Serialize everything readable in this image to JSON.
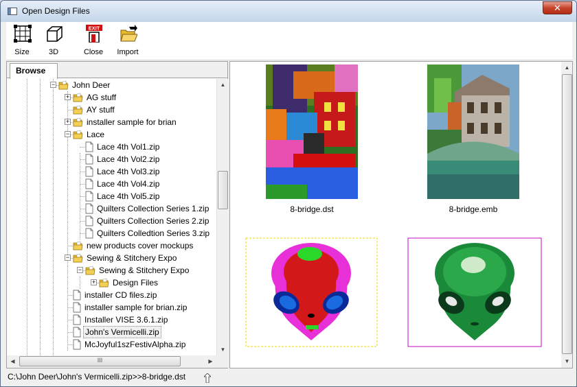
{
  "window": {
    "title": "Open Design Files",
    "close_glyph": "✕"
  },
  "toolbar": {
    "items": [
      {
        "label": "Size",
        "icon": "size-grid-icon"
      },
      {
        "label": "3D",
        "icon": "cube-3d-icon"
      },
      {
        "label": "Close",
        "icon": "exit-door-icon",
        "badge": "EXIT"
      },
      {
        "label": "Import",
        "icon": "open-folder-icon"
      }
    ]
  },
  "left_panel": {
    "tab": "Browse",
    "tree": [
      {
        "label": "John Deer",
        "type": "folder",
        "level": 0,
        "expander": "minus"
      },
      {
        "label": "AG stuff",
        "type": "folder",
        "level": 1,
        "expander": "plus"
      },
      {
        "label": "AY stuff",
        "type": "folder",
        "level": 1,
        "expander": ""
      },
      {
        "label": "installer sample for brian",
        "type": "folder",
        "level": 1,
        "expander": "plus"
      },
      {
        "label": "Lace",
        "type": "folder",
        "level": 1,
        "expander": "minus"
      },
      {
        "label": "Lace 4th Vol1.zip",
        "type": "file",
        "level": 2
      },
      {
        "label": "Lace 4th Vol2.zip",
        "type": "file",
        "level": 2
      },
      {
        "label": "Lace 4th Vol3.zip",
        "type": "file",
        "level": 2
      },
      {
        "label": "Lace 4th Vol4.zip",
        "type": "file",
        "level": 2
      },
      {
        "label": "Lace 4th Vol5.zip",
        "type": "file",
        "level": 2
      },
      {
        "label": "Quilters Collection Series 1.zip",
        "type": "file",
        "level": 2
      },
      {
        "label": "Quilters Collection Series 2.zip",
        "type": "file",
        "level": 2
      },
      {
        "label": "Quilters Colledtion Series 3.zip",
        "type": "file",
        "level": 2
      },
      {
        "label": "new products cover mockups",
        "type": "folder",
        "level": 1,
        "expander": ""
      },
      {
        "label": "Sewing & Stitchery Expo",
        "type": "folder",
        "level": 1,
        "expander": "minus"
      },
      {
        "label": "Sewing & Stitchery Expo",
        "type": "folder",
        "level": 2,
        "expander": "minus"
      },
      {
        "label": "Design Files",
        "type": "folder",
        "level": 3,
        "expander": "plus"
      },
      {
        "label": "installer CD files.zip",
        "type": "file",
        "level": 1
      },
      {
        "label": "installer sample for brian.zip",
        "type": "file",
        "level": 1
      },
      {
        "label": "Installer VISE 3.6.1.zip",
        "type": "file",
        "level": 1
      },
      {
        "label": "John's Vermicelli.zip",
        "type": "file",
        "level": 1,
        "selected": true
      },
      {
        "label": "McJoyful1szFestivAlpha.zip",
        "type": "file",
        "level": 1
      }
    ],
    "hscroll_grip": "III"
  },
  "designs": [
    {
      "caption": "8-bridge.dst",
      "kind": "bridge-dst"
    },
    {
      "caption": "8-bridge.emb",
      "kind": "bridge-emb"
    },
    {
      "caption": "",
      "kind": "alien-dst",
      "frame_color": "#e8d800"
    },
    {
      "caption": "",
      "kind": "alien-emb",
      "frame_color": "#cc33cc"
    }
  ],
  "status": {
    "path": "C:\\John Deer\\John's Vermicelli.zip>>8-bridge.dst"
  }
}
